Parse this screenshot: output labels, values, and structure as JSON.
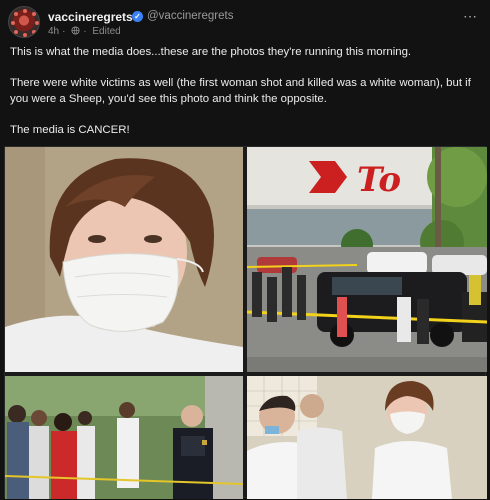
{
  "post": {
    "author_name": "vaccineregrets",
    "author_handle": "@vaccineregrets",
    "time": "4h",
    "edited": "Edited",
    "paragraphs": [
      "This is what the media does...these are the photos they're running this morning.",
      "There were white victims as well (the first woman shot and killed was a white woman), but if you were a Sheep, you'd see this photo and think the opposite.",
      "The media is CANCER!"
    ],
    "more_icon": "⋯",
    "verified_icon": "✓",
    "globe_icon": "globe-icon"
  },
  "photos": [
    {
      "name": "young-man-mask-photo"
    },
    {
      "name": "store-police-scene-photo",
      "sign_text": "To"
    },
    {
      "name": "crowd-officer-photo"
    },
    {
      "name": "courtroom-photo"
    }
  ]
}
